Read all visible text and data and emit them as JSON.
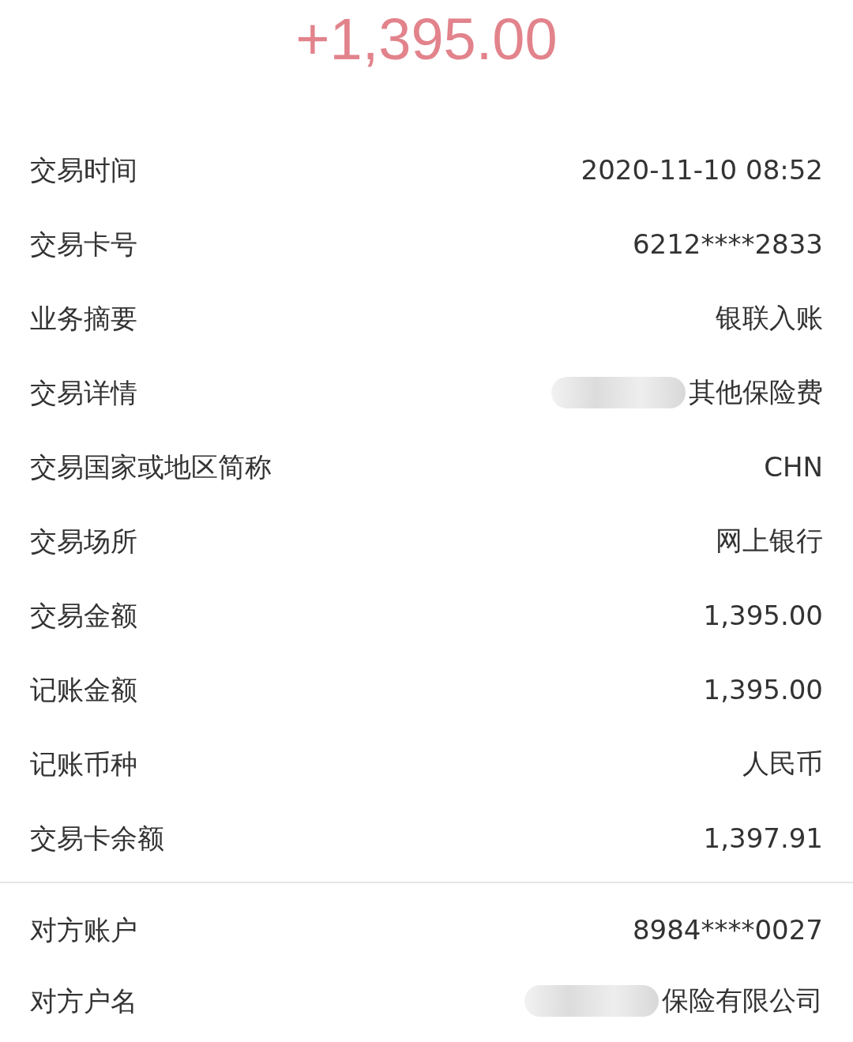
{
  "amount": "+1,395.00",
  "sections": [
    {
      "rows": [
        {
          "label": "交易时间",
          "value": "2020-11-10 08:52",
          "redacted": false
        },
        {
          "label": "交易卡号",
          "value": "6212****2833",
          "redacted": false
        },
        {
          "label": "业务摘要",
          "value": "银联入账",
          "redacted": false
        },
        {
          "label": "交易详情",
          "value": "其他保险费",
          "redacted": true
        },
        {
          "label": "交易国家或地区简称",
          "value": "CHN",
          "redacted": false
        },
        {
          "label": "交易场所",
          "value": "网上银行",
          "redacted": false
        },
        {
          "label": "交易金额",
          "value": "1,395.00",
          "redacted": false
        },
        {
          "label": "记账金额",
          "value": "1,395.00",
          "redacted": false
        },
        {
          "label": "记账币种",
          "value": "人民币",
          "redacted": false
        },
        {
          "label": "交易卡余额",
          "value": "1,397.91",
          "redacted": false
        }
      ]
    },
    {
      "rows": [
        {
          "label": "对方账户",
          "value": "8984****0027",
          "redacted": false
        },
        {
          "label": "对方户名",
          "value": "保险有限公司",
          "redacted": true
        }
      ]
    }
  ]
}
